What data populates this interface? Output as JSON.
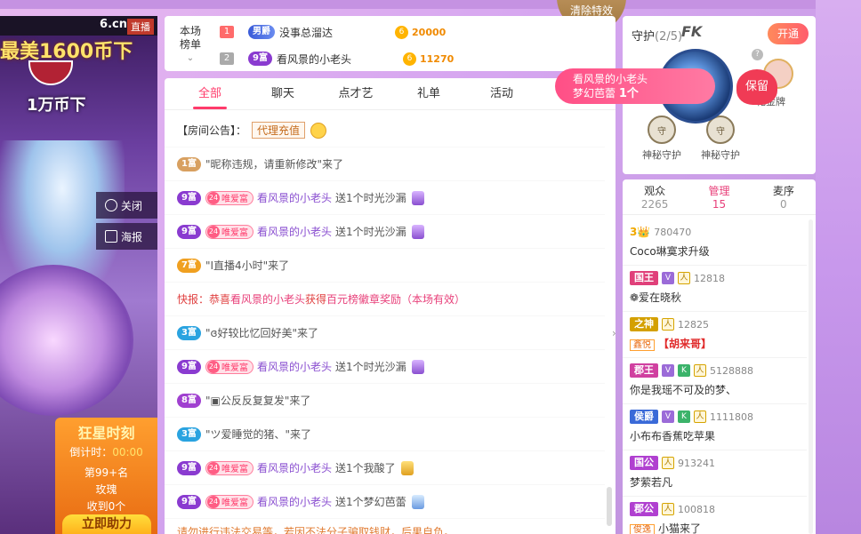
{
  "video": {
    "site": "6.cn",
    "live_badge": "直播",
    "promo_line1": "最美1600币下",
    "promo_line2": "1万币下",
    "close_label": "关闭",
    "poster_label": "海报",
    "event_title": "狂星时刻",
    "countdown_label": "倒计时：",
    "countdown_value": "00:00",
    "rank_label": "第99+名",
    "gift_name": "玫瑰",
    "received": "收到0个",
    "help_button": "立即助力"
  },
  "effect_button": "清除特效",
  "ranking": {
    "label": "本场榜单",
    "rows": [
      {
        "rank": "1",
        "badge": "男爵",
        "name": "没事总溜达",
        "score": "20000"
      },
      {
        "rank": "2",
        "badge": "9富",
        "name": "看风景的小老头",
        "score": "11270"
      }
    ]
  },
  "chat": {
    "tabs": [
      "全部",
      "聊天",
      "点才艺",
      "礼单",
      "活动"
    ],
    "announce_label": "【房间公告】：",
    "announce_tag": "代理充值",
    "messages": [
      {
        "badge": "1富",
        "text": "\"昵称违规，请重新修改\"来了"
      },
      {
        "badge": "9富",
        "vip": "唯爱富",
        "user": "看风景的小老头",
        "text": "送1个时光沙漏"
      },
      {
        "badge": "9富",
        "vip": "唯爱富",
        "user": "看风景的小老头",
        "text": "送1个时光沙漏"
      },
      {
        "badge": "7富",
        "text": "\"I直播4小时\"来了"
      },
      {
        "notice": true,
        "prefix": "快报：恭喜 ",
        "user": "看风景的小老头",
        "mid": " 获得 ",
        "award": "百元榜徽章奖励（本场有效）"
      },
      {
        "badge": "3富",
        "text": "\"ɞ好较比忆回好美\"来了"
      },
      {
        "badge": "9富",
        "vip": "唯爱富",
        "user": "看风景的小老头",
        "text": "送1个时光沙漏"
      },
      {
        "badge": "8富",
        "text": "\"▣公反反复复发\"来了"
      },
      {
        "badge": "3富",
        "text": "\"ツ爱睡觉的猪、\"来了"
      },
      {
        "badge": "9富",
        "vip": "唯爱富",
        "user": "看风景的小老头",
        "text": "送1个我酸了"
      },
      {
        "badge": "9富",
        "vip": "唯爱富",
        "user": "看风景的小老头",
        "text": "送1个梦幻芭蕾"
      }
    ],
    "vip_level": "24",
    "bottom_hint": "请勿进行违法交易等，若因不法分子骗取钱财，后果自负。"
  },
  "gift_popup": {
    "user": "看风景的小老头",
    "gift": "梦幻芭蕾",
    "count": "1个"
  },
  "guard": {
    "title": "守护",
    "count": "(2/5)",
    "fk": "FK",
    "open_button": "开通",
    "help": "?",
    "keep_label": "保留",
    "members": [
      {
        "name": "神秘守护",
        "avatar": "守"
      },
      {
        "name": "神秘守护",
        "avatar": "守"
      }
    ],
    "gold_name": "花金牌"
  },
  "audience": {
    "tabs": [
      {
        "label": "观众",
        "count": "2265"
      },
      {
        "label": "管理",
        "count": "15"
      },
      {
        "label": "麦序",
        "count": "0"
      }
    ],
    "items": [
      {
        "crown": "3👑",
        "uid": "780470",
        "name": "Coco琳寞求升级"
      },
      {
        "rank": "国王",
        "rank_color": "#e0407a",
        "icons": [
          "V",
          "P"
        ],
        "uid": "12818",
        "name": "❁爱在晓秋"
      },
      {
        "rank": "之神",
        "rank_color": "#d4a000",
        "icons": [
          "P"
        ],
        "uid": "12825",
        "tag": "鑫悦",
        "name": "【胡来哥】"
      },
      {
        "rank": "郡王",
        "rank_color": "#d040a0",
        "icons": [
          "V",
          "K",
          "P"
        ],
        "uid": "5128888",
        "name": "你是我瑶不可及的梦、"
      },
      {
        "rank": "侯爵",
        "rank_color": "#3a6ad8",
        "icons": [
          "V",
          "K",
          "P"
        ],
        "uid": "1111808",
        "name": "小布布香蕉吃苹果"
      },
      {
        "rank": "国公",
        "rank_color": "#b040d0",
        "icons": [
          "P"
        ],
        "uid": "913241",
        "name": "梦萦若凡"
      },
      {
        "rank": "郡公",
        "rank_color": "#b040d0",
        "icons": [
          "P"
        ],
        "uid": "100818",
        "tag": "俊逸",
        "name": "小猫来了"
      }
    ]
  },
  "colors": {
    "accent": "#ff3b6b",
    "badge_9": "#8a3bd0",
    "badge_3": "#2aa3e0",
    "badge_7": "#f0a020",
    "badge_8": "#a040d0"
  }
}
